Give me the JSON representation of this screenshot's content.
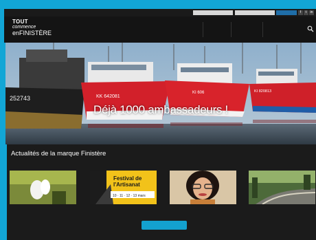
{
  "utility": {
    "text": "",
    "link": "",
    "social": [
      "f",
      "t",
      "in"
    ]
  },
  "logo": {
    "line1": "TOUT",
    "line2": "commence",
    "line3a": "en",
    "line3b": "FINISTÈRE"
  },
  "nav": {
    "items": [
      {
        "label": ""
      },
      {
        "label": ""
      },
      {
        "label": ""
      }
    ]
  },
  "hero": {
    "caption": "Déjà 1000 ambassadeurs !",
    "boat_numbers": [
      "252743",
      "KK 642081",
      "KI 606",
      "KI 820813"
    ]
  },
  "news": {
    "title": "Actualités de la marque Finistère",
    "poster": {
      "line1": "Festival de",
      "line2": "l'Artisanat",
      "dates": "10 · 11 · 12 · 13 mars"
    },
    "cards": [
      {
        "caption": ""
      },
      {
        "caption": ""
      },
      {
        "caption": ""
      },
      {
        "caption": ""
      }
    ],
    "more_label": ""
  },
  "colors": {
    "frame": "#12a6d6",
    "header": "#141414",
    "accent": "#13a1cf",
    "caption": "#9bd1ea"
  }
}
